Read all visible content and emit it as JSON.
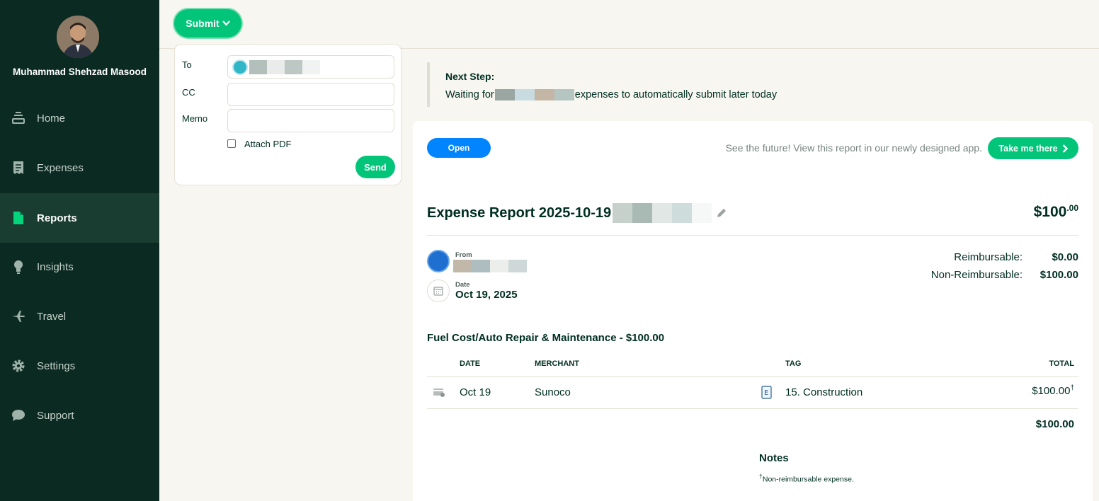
{
  "user": {
    "name": "Muhammad Shehzad Masood"
  },
  "sidebar": {
    "items": [
      {
        "label": "Home",
        "icon": "home-icon",
        "active": false
      },
      {
        "label": "Expenses",
        "icon": "receipt-icon",
        "active": false
      },
      {
        "label": "Reports",
        "icon": "document-icon",
        "active": true
      },
      {
        "label": "Insights",
        "icon": "lightbulb-icon",
        "active": false
      },
      {
        "label": "Travel",
        "icon": "plane-icon",
        "active": false
      },
      {
        "label": "Settings",
        "icon": "gear-icon",
        "active": false
      },
      {
        "label": "Support",
        "icon": "chat-bubble-icon",
        "active": false
      }
    ]
  },
  "submit_menu": {
    "button_label": "Submit",
    "to_label": "To",
    "cc_label": "CC",
    "memo_label": "Memo",
    "attach_label": "Attach PDF",
    "attach_checked": false,
    "send_label": "Send"
  },
  "next_step": {
    "title": "Next Step:",
    "prefix": "Waiting for",
    "suffix": "expenses to automatically submit later today"
  },
  "report": {
    "status": "Open",
    "promo_text": "See the future! View this report in our newly designed app.",
    "promo_button": "Take me there",
    "title": "Expense Report 2025-10-19",
    "total_main": "$100",
    "total_cents": ".00",
    "from_label": "From",
    "date_label": "Date",
    "date_value": "Oct 19, 2025",
    "reimbursable_label": "Reimbursable:",
    "reimbursable_value": "$0.00",
    "non_reimbursable_label": "Non-Reimbursable:",
    "non_reimbursable_value": "$100.00",
    "category_heading": "Fuel Cost/Auto Repair & Maintenance - $100.00",
    "columns": {
      "date": "DATE",
      "merchant": "MERCHANT",
      "tag": "TAG",
      "total": "TOTAL"
    },
    "rows": [
      {
        "date": "Oct 19",
        "merchant": "Sunoco",
        "tag": "15. Construction",
        "total": "$100.00",
        "mark": "†"
      }
    ],
    "grand_total": "$100.00",
    "notes_title": "Notes",
    "notes_mark": "†",
    "notes_text": "Non-reimbursable expense."
  },
  "colors": {
    "sidebar_bg": "#0b2a21",
    "accent_green": "#03c57a",
    "accent_blue": "#0185ff",
    "text_dark": "#002e22"
  }
}
